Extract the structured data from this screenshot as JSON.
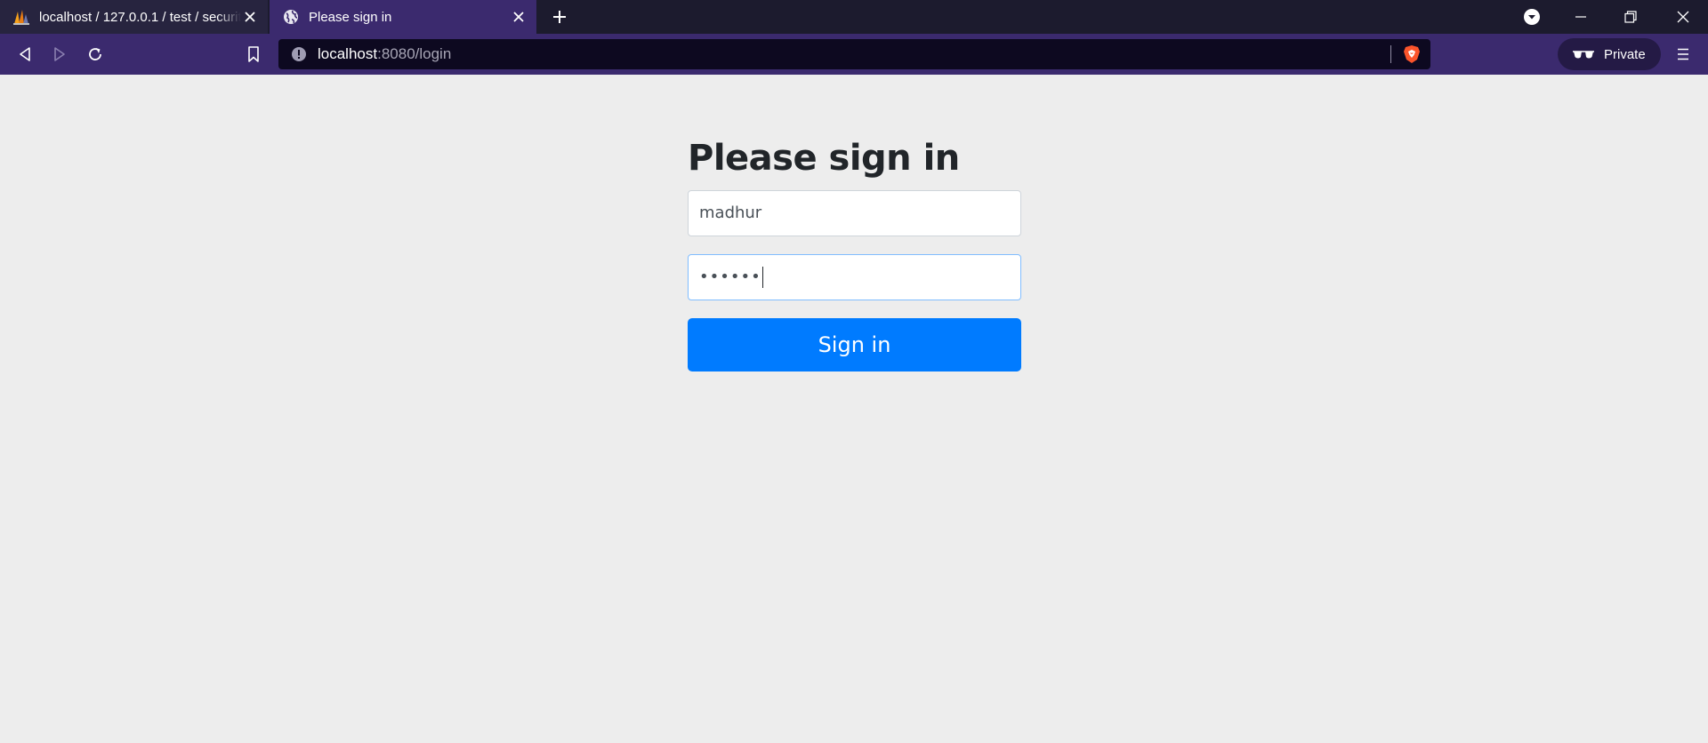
{
  "browser": {
    "tabs": [
      {
        "title": "localhost / 127.0.0.1 / test / securit",
        "icon": "phpmyadmin-icon",
        "active": false
      },
      {
        "title": "Please sign in",
        "icon": "globe-icon",
        "active": true
      }
    ],
    "url": {
      "host": "localhost",
      "rest": ":8080/login"
    },
    "private_label": "Private"
  },
  "login": {
    "heading": "Please sign in",
    "username_value": "madhur",
    "password_value": "••••••",
    "submit_label": "Sign in"
  },
  "colors": {
    "accent": "#007bff",
    "toolbar": "#3b2a6e",
    "tabstrip": "#1c1b2e",
    "page_bg": "#ededed"
  }
}
